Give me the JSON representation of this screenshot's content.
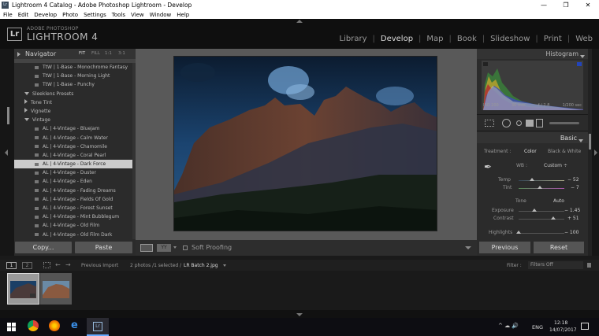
{
  "window": {
    "title": "Lightroom 4 Catalog - Adobe Photoshop Lightroom - Develop",
    "controls": [
      "—",
      "❐",
      "✕"
    ]
  },
  "menu": [
    "File",
    "Edit",
    "Develop",
    "Photo",
    "Settings",
    "Tools",
    "View",
    "Window",
    "Help"
  ],
  "identity": {
    "logo": "Lr",
    "line1": "ADOBE PHOTOSHOP",
    "line2": "LIGHTROOM 4"
  },
  "modules": [
    "Library",
    "Develop",
    "Map",
    "Book",
    "Slideshow",
    "Print",
    "Web"
  ],
  "active_module": "Develop",
  "navigator": {
    "title": "Navigator",
    "zoom_options": [
      "FIT",
      "FILL",
      "1:1",
      "3:1"
    ]
  },
  "presets": [
    {
      "label": "TtW | 1-Base - Monochrome Fantasy",
      "kind": "item"
    },
    {
      "label": "TtW | 1-Base - Morning Light",
      "kind": "item"
    },
    {
      "label": "TtW | 1-Base - Punchy",
      "kind": "item"
    },
    {
      "label": "Sleeklens Presets",
      "kind": "folder-open"
    },
    {
      "label": "Tone Tint",
      "kind": "folder"
    },
    {
      "label": "Vignette",
      "kind": "folder"
    },
    {
      "label": "Vintage",
      "kind": "folder-open"
    },
    {
      "label": "AL | 4-Vintage - Bluejam",
      "kind": "item"
    },
    {
      "label": "AL | 4-Vintage - Calm Water",
      "kind": "item"
    },
    {
      "label": "AL | 4-Vintage - Chamomile",
      "kind": "item"
    },
    {
      "label": "AL | 4-Vintage - Coral Pearl",
      "kind": "item"
    },
    {
      "label": "AL | 4-Vintage - Dark Force",
      "kind": "item-selected"
    },
    {
      "label": "AL | 4-Vintage - Duster",
      "kind": "item"
    },
    {
      "label": "AL | 4-Vintage - Eden",
      "kind": "item"
    },
    {
      "label": "AL | 4-Vintage - Fading Dreams",
      "kind": "item"
    },
    {
      "label": "AL | 4-Vintage - Fields Of Gold",
      "kind": "item"
    },
    {
      "label": "AL | 4-Vintage - Forest Sunset",
      "kind": "item"
    },
    {
      "label": "AL | 4-Vintage - Mint Bubblegum",
      "kind": "item"
    },
    {
      "label": "AL | 4-Vintage - Old Film",
      "kind": "item"
    },
    {
      "label": "AL | 4-Vintage - Old Film Dark",
      "kind": "item"
    }
  ],
  "left_buttons": {
    "copy": "Copy...",
    "paste": "Paste"
  },
  "toolbar": {
    "soft_proofing": "Soft Proofing",
    "view_label": "YY"
  },
  "histogram": {
    "title": "Histogram",
    "iso": "ISO 200",
    "focal": "30 mm",
    "aperture": "f / 2.8",
    "shutter": "1/200 sec"
  },
  "basic": {
    "title": "Basic",
    "treatment_label": "Treatment :",
    "treatment_color": "Color",
    "treatment_bw": "Black & White",
    "wb_label": "WB :",
    "wb_value": "Custom ÷",
    "temp_label": "Temp",
    "temp_value": "− 52",
    "temp_level": 0.3,
    "tint_label": "Tint",
    "tint_value": "− 7",
    "tint_level": 0.47,
    "tone_label": "Tone",
    "auto_label": "Auto",
    "exposure_label": "Exposure",
    "exposure_value": "− 1.45",
    "exposure_level": 0.35,
    "contrast_label": "Contrast",
    "contrast_value": "+ 51",
    "contrast_level": 0.75,
    "highlights_label": "Highlights",
    "highlights_value": "− 100",
    "highlights_level": 0.0
  },
  "right_buttons": {
    "previous": "Previous",
    "reset": "Reset"
  },
  "filmstrip": {
    "page1": "1",
    "page2": "2",
    "source": "Previous Import",
    "status": "2 photos /1 selected /",
    "filename": "LR Batch 2.jpg",
    "filter_label": "Filter :",
    "filter_value": "Filters Off"
  },
  "taskbar": {
    "language": "ENG",
    "time": "12:18",
    "date": "14/07/2017"
  },
  "colors": {
    "accent": "#dddddd",
    "panel": "#2b2b2b",
    "selected_row": "#cccccc"
  }
}
